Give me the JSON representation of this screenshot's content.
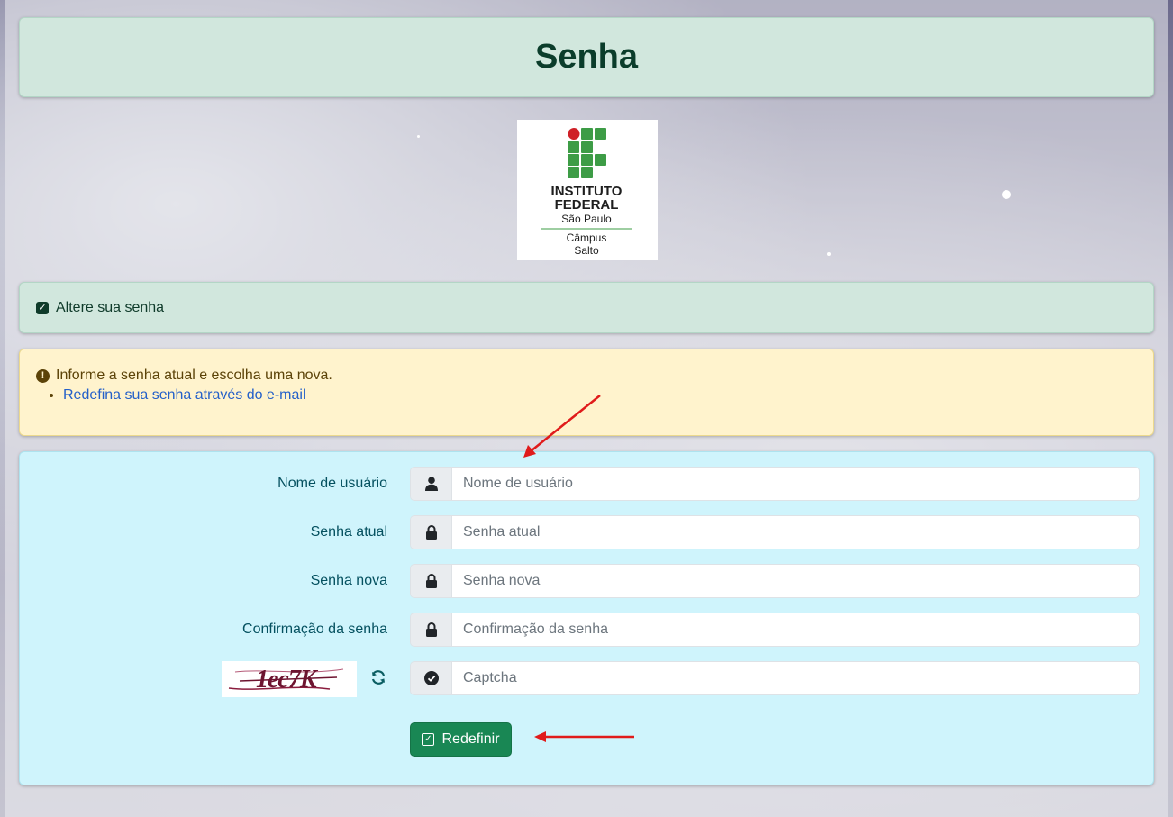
{
  "header": {
    "title": "Senha"
  },
  "logo": {
    "line1": "INSTITUTO",
    "line2": "FEDERAL",
    "line3": "São Paulo",
    "line4": "Câmpus",
    "line5": "Salto",
    "colors": {
      "green": "#3d9c46",
      "red": "#cf2027"
    }
  },
  "alert_success": {
    "icon": "check-square-icon",
    "text": "Altere sua senha"
  },
  "alert_warning": {
    "icon": "exclamation-circle-icon",
    "text": "Informe a senha atual e escolha uma nova.",
    "link_text": "Redefina sua senha através do e-mail"
  },
  "form": {
    "username": {
      "label": "Nome de usuário",
      "placeholder": "Nome de usuário",
      "value": "",
      "icon": "user-icon"
    },
    "current_password": {
      "label": "Senha atual",
      "placeholder": "Senha atual",
      "value": "",
      "icon": "lock-icon"
    },
    "new_password": {
      "label": "Senha nova",
      "placeholder": "Senha nova",
      "value": "",
      "icon": "lock-icon"
    },
    "confirm_password": {
      "label": "Confirmação da senha",
      "placeholder": "Confirmação da senha",
      "value": "",
      "icon": "lock-icon"
    },
    "captcha": {
      "image_text": "1ec7K",
      "placeholder": "Captcha",
      "value": "",
      "icon": "check-circle-icon",
      "refresh_icon": "refresh-icon"
    },
    "submit_label": "Redefinir"
  },
  "colors": {
    "success_bg": "#d1e7dd",
    "warning_bg": "#fff3cd",
    "info_bg": "#cff4fc",
    "button": "#198754",
    "annotation_arrow": "#e01b1b"
  }
}
